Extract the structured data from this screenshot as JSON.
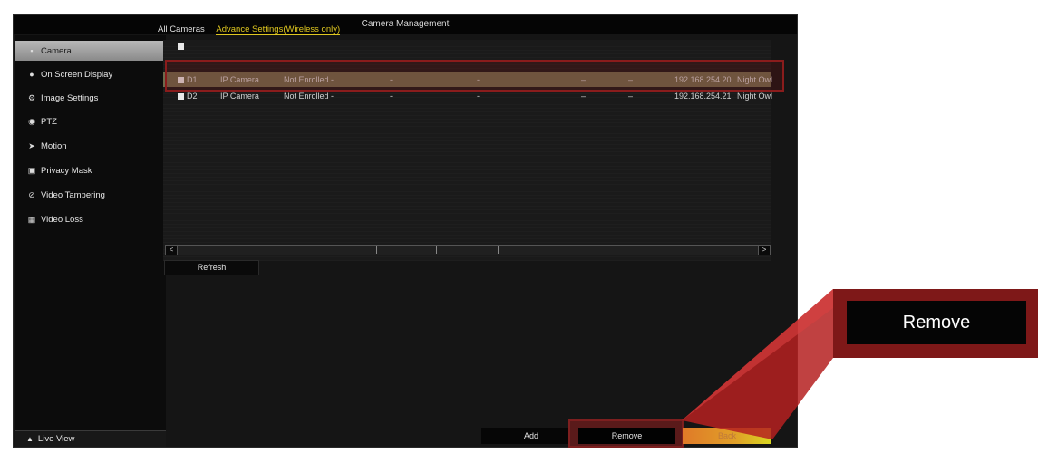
{
  "window": {
    "title": "Camera Management"
  },
  "sidebar": {
    "items": [
      {
        "label": "Camera",
        "icon": "camera-icon",
        "active": true
      },
      {
        "label": "On Screen Display",
        "icon": "info-icon",
        "active": false
      },
      {
        "label": "Image Settings",
        "icon": "image-settings-icon",
        "active": false
      },
      {
        "label": "PTZ",
        "icon": "ptz-icon",
        "active": false
      },
      {
        "label": "Motion",
        "icon": "motion-icon",
        "active": false
      },
      {
        "label": "Privacy Mask",
        "icon": "privacy-mask-icon",
        "active": false
      },
      {
        "label": "Video Tampering",
        "icon": "video-tampering-icon",
        "active": false
      },
      {
        "label": "Video Loss",
        "icon": "video-loss-icon",
        "active": false
      }
    ],
    "live_view": "Live View"
  },
  "tabs": [
    {
      "label": "All Cameras",
      "active": false
    },
    {
      "label": "Advance Settings(Wireless only)",
      "active": true
    }
  ],
  "table": {
    "rows": [
      {
        "id": "D1",
        "type": "IP Camera",
        "status": "Not Enrolled -",
        "c4": "-",
        "c5": "-",
        "c6": "–",
        "c7": "–",
        "ip": "192.168.254.20",
        "vendor": "Night Owl",
        "selected": true
      },
      {
        "id": "D2",
        "type": "IP Camera",
        "status": "Not Enrolled -",
        "c4": "-",
        "c5": "-",
        "c6": "–",
        "c7": "–",
        "ip": "192.168.254.21",
        "vendor": "Night Owl",
        "selected": false
      }
    ]
  },
  "buttons": {
    "refresh": "Refresh",
    "add": "Add",
    "remove": "Remove",
    "back": "Back"
  },
  "callout": {
    "label": "Remove"
  },
  "colors": {
    "accent_yellow": "#e0c820",
    "highlight_red": "#8a1c1c",
    "selected_row": "#6d6a4c"
  }
}
